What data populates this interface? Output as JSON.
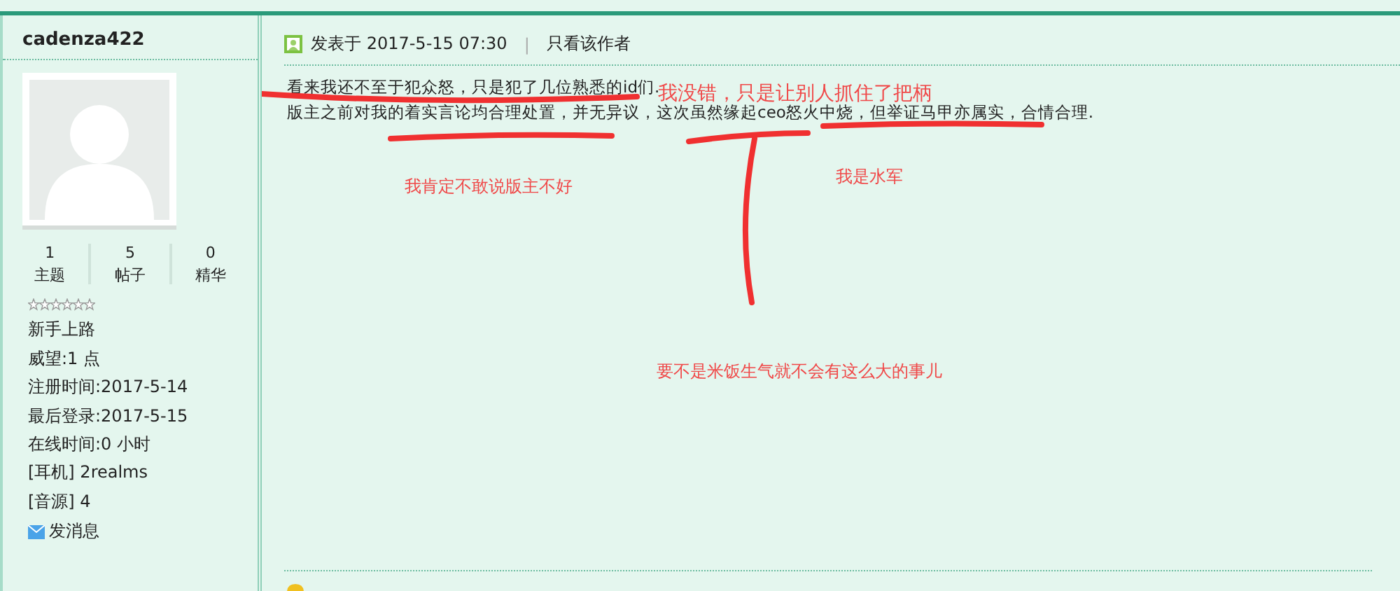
{
  "author": {
    "name": "cadenza422",
    "stats": [
      {
        "value": "1",
        "label": "主题"
      },
      {
        "value": "5",
        "label": "帖子"
      },
      {
        "value": "0",
        "label": "精华"
      }
    ],
    "rank": "新手上路",
    "info": [
      "威望:1 点",
      "注册时间:2017-5-14",
      "最后登录:2017-5-15",
      "在线时间:0 小时",
      "[耳机] 2realms",
      "[音源] 4"
    ],
    "message_link": "发消息"
  },
  "post": {
    "posted": "发表于 2017-5-15 07:30",
    "separator": "|",
    "only_author": "只看该作者",
    "lines": [
      "看来我还不至于犯众怒，只是犯了几位熟悉的id们.",
      "版主之前对我的着实言论均合理处置，并无异议，这次虽然缘起ceo怒火中烧，但举证马甲亦属实，合情合理."
    ]
  },
  "annotations": [
    {
      "text": "我没错，只是让别人抓住了把柄"
    },
    {
      "text": "我肯定不敢说版主不好"
    },
    {
      "text": "我是水军"
    },
    {
      "text": "要不是米饭生气就不会有这么大的事儿"
    }
  ]
}
